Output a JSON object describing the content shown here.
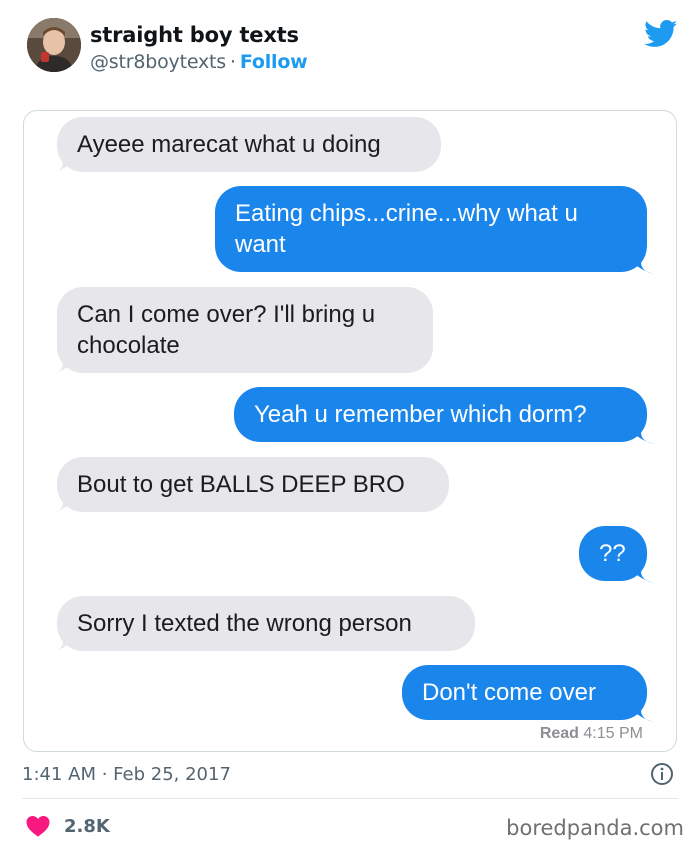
{
  "tweet": {
    "author_name": "straight boy texts",
    "handle": "@str8boytexts",
    "separator": "·",
    "follow_label": "Follow",
    "timestamp": "1:41 AM · Feb 25, 2017",
    "likes": "2.8K"
  },
  "messages": [
    {
      "side": "in",
      "text": "Ayeee marecat what u doing"
    },
    {
      "side": "out",
      "text": "Eating chips...crine...why what u",
      "text2": "want"
    },
    {
      "side": "in",
      "text": "Can I come over? I'll bring u",
      "text2": "chocolate"
    },
    {
      "side": "out",
      "text": "Yeah u remember which dorm?"
    },
    {
      "side": "in",
      "text": "Bout to get BALLS DEEP BRO"
    },
    {
      "side": "out",
      "text": "??"
    },
    {
      "side": "in",
      "text": "Sorry I texted the wrong person"
    },
    {
      "side": "out",
      "text": "Don't come over"
    }
  ],
  "receipt": {
    "label": "Read",
    "time": "4:15 PM"
  },
  "watermark": "boredpanda.com",
  "icons": {
    "bird": "twitter-bird-icon",
    "info": "info-icon",
    "heart": "heart-icon"
  },
  "colors": {
    "twitter_blue": "#1d9bf0",
    "imessage_blue": "#1a86ec",
    "incoming_gray": "#e6e6eb",
    "heart": "#f91880"
  }
}
